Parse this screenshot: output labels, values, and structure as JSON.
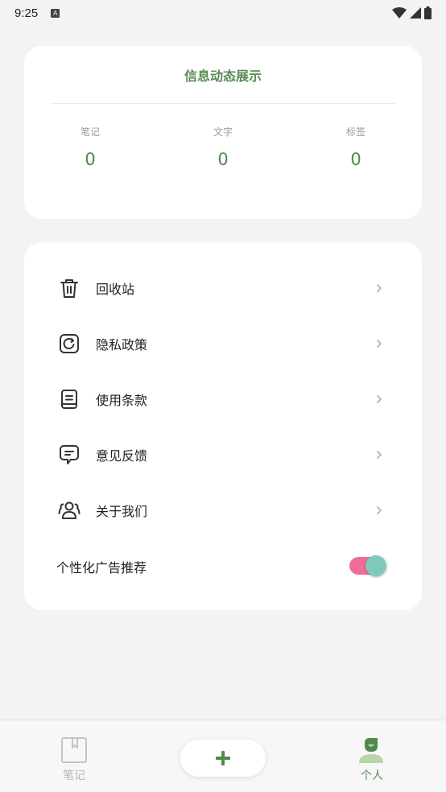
{
  "status_bar": {
    "time": "9:25",
    "notification_glyph": "A"
  },
  "info_card": {
    "title": "信息动态展示",
    "stats": [
      {
        "label": "笔记",
        "value": "0"
      },
      {
        "label": "文字",
        "value": "0"
      },
      {
        "label": "标签",
        "value": "0"
      }
    ]
  },
  "menu": {
    "items": [
      {
        "label": "回收站",
        "icon": "trash-icon"
      },
      {
        "label": "隐私政策",
        "icon": "privacy-icon"
      },
      {
        "label": "使用条款",
        "icon": "document-icon"
      },
      {
        "label": "意见反馈",
        "icon": "chat-icon"
      },
      {
        "label": "关于我们",
        "icon": "users-icon"
      }
    ],
    "ad_toggle": {
      "label": "个性化广告推荐",
      "on": true
    }
  },
  "bottom_nav": {
    "tabs": [
      {
        "label": "笔记",
        "icon": "notebook-icon",
        "active": false
      },
      {
        "label": "个人",
        "icon": "person-icon",
        "active": true
      }
    ],
    "add_icon": "plus-icon"
  },
  "colors": {
    "accent": "#5a8a55",
    "toggle_track": "#f06e96",
    "toggle_knob": "#7fcabd"
  }
}
